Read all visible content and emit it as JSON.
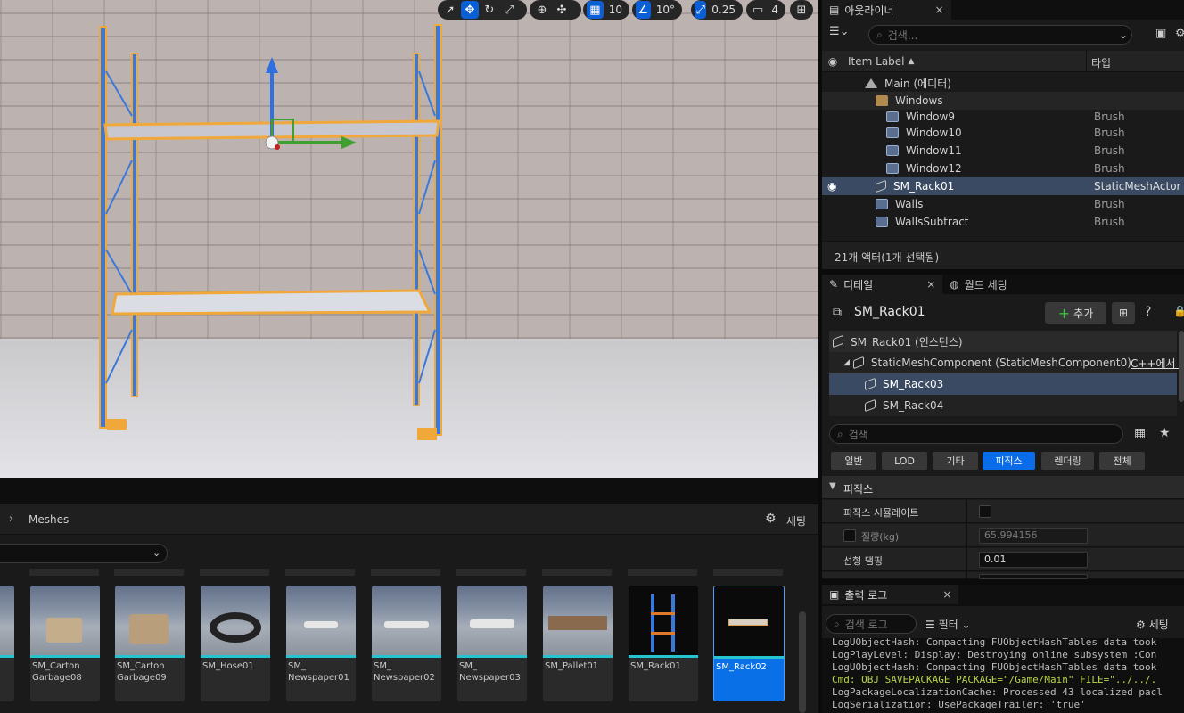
{
  "viewport": {
    "toolbar": {
      "grid_snap": "10",
      "angle_snap": "10°",
      "scale_snap": "0.25",
      "camera_speed": "4"
    }
  },
  "outliner": {
    "tab_label": "아웃라이너",
    "search_placeholder": "검색...",
    "col_label": "Item Label",
    "col_type": "타입",
    "rows": [
      {
        "label": "Main (에디터)",
        "type": ""
      },
      {
        "label": "Windows",
        "type": ""
      },
      {
        "label": "Window9",
        "type": "Brush"
      },
      {
        "label": "Window10",
        "type": "Brush"
      },
      {
        "label": "Window11",
        "type": "Brush"
      },
      {
        "label": "Window12",
        "type": "Brush"
      },
      {
        "label": "SM_Rack01",
        "type": "StaticMeshActor"
      },
      {
        "label": "Walls",
        "type": "Brush"
      },
      {
        "label": "WallsSubtract",
        "type": "Brush"
      }
    ],
    "status": "21개 액터(1개 선택됨)"
  },
  "details": {
    "tab_label": "디테일",
    "tab2_label": "월드 세팅",
    "actor_name": "SM_Rack01",
    "add_label": "추가",
    "components": [
      "SM_Rack01 (인스턴스)",
      "StaticMeshComponent (StaticMeshComponent0)",
      "SM_Rack03",
      "SM_Rack04"
    ],
    "cpp_label": "C++에서 :",
    "search_placeholder": "검색",
    "filters": [
      "일반",
      "LOD",
      "기타",
      "피직스",
      "렌더링",
      "전체"
    ],
    "section": "피직스",
    "props": [
      {
        "label": "피직스 시뮬레이트",
        "value": ""
      },
      {
        "label": "질량(kg)",
        "value": "65.994156"
      },
      {
        "label": "선형 댐핑",
        "value": "0.01"
      }
    ]
  },
  "outlog": {
    "tab_label": "출력 로그",
    "search_placeholder": "검색 로그",
    "filter_label": "필터",
    "settings_label": "세팅",
    "lines": [
      "LogUObjectHash: Compacting FUObjectHashTables data took",
      "LogPlayLevel: Display: Destroying online subsystem :Con",
      "LogUObjectHash: Compacting FUObjectHashTables data took",
      "Cmd: OBJ SAVEPACKAGE PACKAGE=\"/Game/Main\" FILE=\"../../.",
      "LogPackageLocalizationCache: Processed 43 localized pacl",
      "LogSerialization: UsePackageTrailer: 'true'"
    ],
    "cmd_color": "#b7d548"
  },
  "content": {
    "path_label": "Meshes",
    "settings_label": "세팅",
    "assets": [
      {
        "name": "SM_Carton\nGarbage08"
      },
      {
        "name": "SM_Carton\nGarbage09"
      },
      {
        "name": "SM_Hose01"
      },
      {
        "name": "SM_\nNewspaper01"
      },
      {
        "name": "SM_\nNewspaper02"
      },
      {
        "name": "SM_\nNewspaper03"
      },
      {
        "name": "SM_Pallet01"
      },
      {
        "name": "SM_Rack01"
      },
      {
        "name": "SM_Rack02"
      }
    ]
  },
  "colors": {
    "accent": "#0a6ce8",
    "selection": "#3a4a63",
    "asset_bar": "#24c5cf"
  }
}
